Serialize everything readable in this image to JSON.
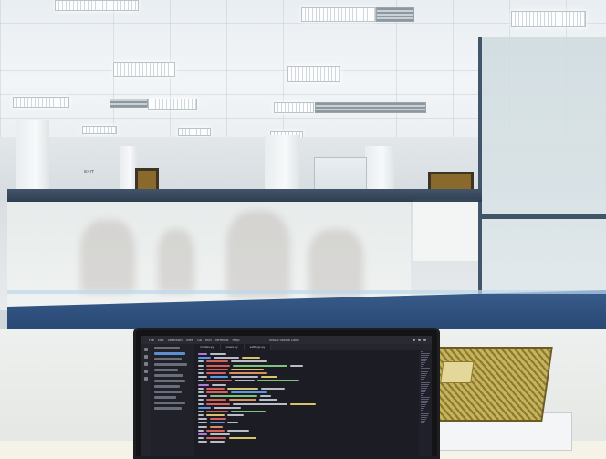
{
  "scene": {
    "sign_text": "EXIT",
    "window_title": "Visual Studio Code",
    "menu": [
      "File",
      "Edit",
      "Selection",
      "View",
      "Go",
      "Run",
      "Terminal",
      "Help"
    ],
    "tabs": [
      "models.py",
      "views.py",
      "settings.py"
    ]
  },
  "colors": {
    "ledge_blue": "#2e4f7c",
    "partition_frame": "#41566a",
    "editor_bg": "#1c1c24",
    "book_gold": "#c7b35a"
  }
}
